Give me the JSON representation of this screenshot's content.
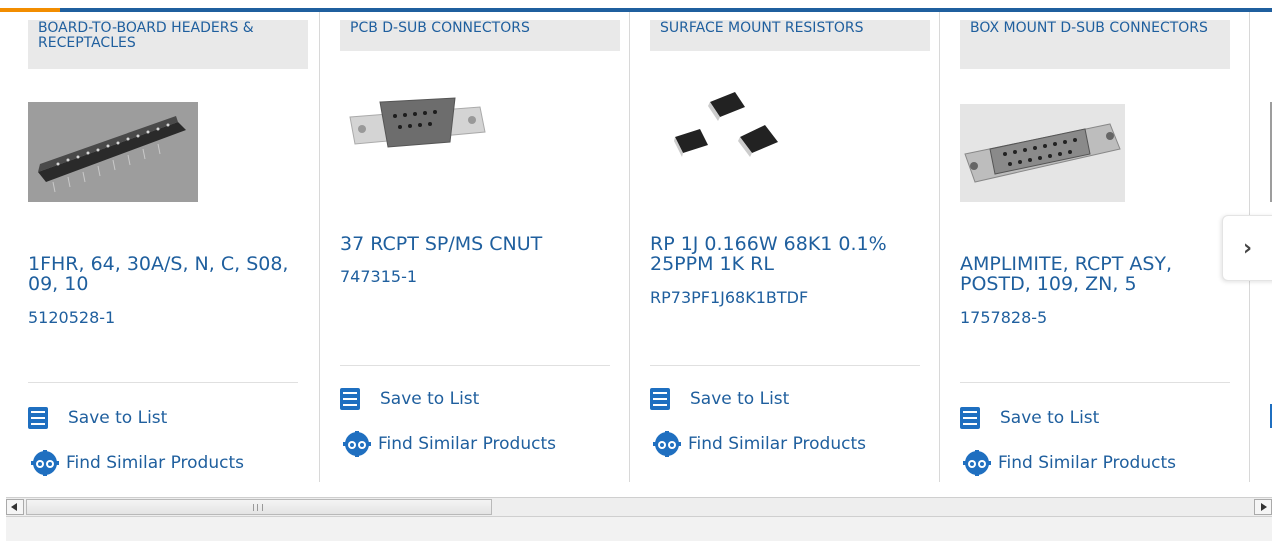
{
  "accent_colors": {
    "brand_blue": "#1f5f9e",
    "orange": "#f28d00",
    "icon_blue": "#1f6fc0"
  },
  "cards": [
    {
      "category": "BOARD-TO-BOARD HEADERS & RECEPTACLES",
      "title": "1FHR, 64, 30A/S, N, C, S08, 09, 10",
      "part_number": "5120528-1",
      "save_label": "Save to List",
      "similar_label": "Find Similar Products"
    },
    {
      "category": "PCB D-SUB CONNECTORS",
      "title": "37 RCPT SP/MS CNUT",
      "part_number": "747315-1",
      "save_label": "Save to List",
      "similar_label": "Find Similar Products"
    },
    {
      "category": "SURFACE MOUNT RESISTORS",
      "title": "RP 1J 0.166W 68K1 0.1% 25PPM 1K RL",
      "part_number": "RP73PF1J68K1BTDF",
      "save_label": "Save to List",
      "similar_label": "Find Similar Products"
    },
    {
      "category": "BOX MOUNT D-SUB CONNECTORS",
      "title": "AMPLIMITE, RCPT ASY, POSTD, 109, ZN, 5",
      "part_number": "1757828-5",
      "save_label": "Save to List",
      "similar_label": "Find Similar Products"
    }
  ],
  "next_icon": "chevron-right-icon",
  "scrollbar": {
    "position_fraction": 0.0,
    "visible_fraction": 0.37
  }
}
